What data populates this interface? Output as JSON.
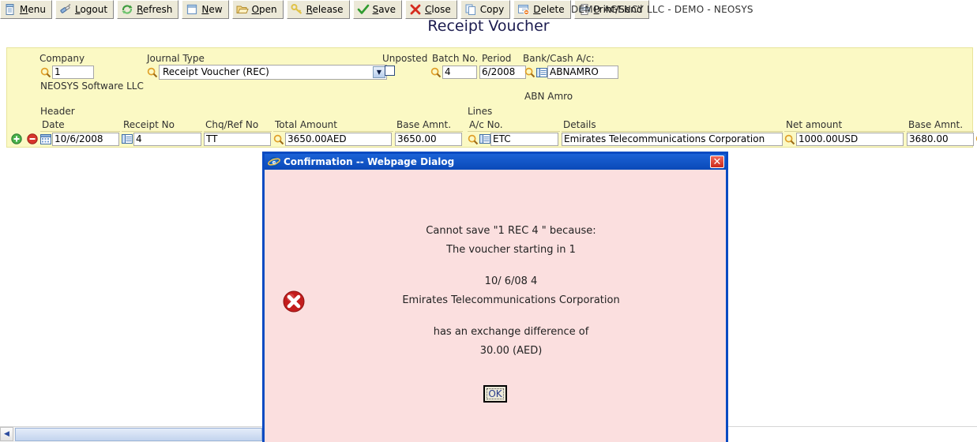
{
  "toolbar": {
    "buttons": [
      {
        "label_pre": "",
        "accel": "M",
        "label_post": "enu",
        "icon": "menu-icon",
        "name": "menu-button"
      },
      {
        "label_pre": "",
        "accel": "L",
        "label_post": "ogout",
        "icon": "logout-icon",
        "name": "logout-button"
      },
      {
        "label_pre": "",
        "accel": "R",
        "label_post": "efresh",
        "icon": "refresh-icon",
        "name": "refresh-button"
      },
      {
        "label_pre": "",
        "accel": "N",
        "label_post": "ew",
        "icon": "new-icon",
        "name": "new-button"
      },
      {
        "label_pre": "",
        "accel": "O",
        "label_post": "pen",
        "icon": "open-folder-icon",
        "name": "open-button"
      },
      {
        "label_pre": "",
        "accel": "R",
        "label_post": "elease",
        "icon": "key-icon",
        "name": "release-button"
      },
      {
        "label_pre": "",
        "accel": "S",
        "label_post": "ave",
        "icon": "check-icon",
        "name": "save-button"
      },
      {
        "label_pre": "",
        "accel": "C",
        "label_post": "lose",
        "icon": "red-x-icon",
        "name": "close-button"
      },
      {
        "label_pre": "",
        "accel": "",
        "label_post": "Copy",
        "icon": "copy-icon",
        "name": "copy-button"
      },
      {
        "label_pre": "",
        "accel": "D",
        "label_post": "elete",
        "icon": "delete-icon",
        "name": "delete-button"
      },
      {
        "label_pre": "",
        "accel": "P",
        "label_post": "rint/Send",
        "icon": "printer-icon",
        "name": "print-send-button"
      }
    ],
    "company_title": "DEMO AGENCY LLC - DEMO - NEOSYS"
  },
  "page": {
    "title": "Receipt Voucher"
  },
  "form": {
    "company": {
      "label": "Company",
      "value": "1",
      "sub": "NEOSYS Software LLC"
    },
    "journal_type": {
      "label": "Journal Type",
      "value": "Receipt Voucher (REC)"
    },
    "unposted": {
      "label": "Unposted",
      "checked": false
    },
    "batch_no": {
      "label": "Batch No.",
      "value": "4"
    },
    "period": {
      "label": "Period",
      "value": "6/2008"
    },
    "bank_cash": {
      "label": "Bank/Cash A/c:",
      "value": "ABNAMRO",
      "sub": "ABN Amro"
    }
  },
  "grid": {
    "group_header": "Header",
    "group_lines": "Lines",
    "header_columns": [
      "Date",
      "Receipt No",
      "Chq/Ref No",
      "Total Amount",
      "Base Amnt."
    ],
    "line_columns": [
      "A/c No.",
      "Details",
      "Net amount",
      "Base Amnt."
    ],
    "row": {
      "date": "10/6/2008",
      "receipt_no": "4",
      "chq_ref_no": "TT",
      "total_amount": "3650.00AED",
      "base_amount_header": "3650.00",
      "ac_no": "ETC",
      "details": "Emirates Telecommunications Corporation",
      "net_amount": "1000.00USD",
      "base_amount_line": "3680.00"
    }
  },
  "dialog": {
    "title": "Confirmation -- Webpage Dialog",
    "close_glyph": "✕",
    "lines": [
      "Cannot save \"1 REC 4 \" because:",
      "The voucher starting in 1",
      "",
      "10/ 6/08 4",
      "Emirates Telecommunications Corporation",
      "",
      "has an exchange difference of",
      "30.00 (AED)"
    ],
    "ok_label": "OK"
  },
  "scrollbar": {
    "left_arrow": "◀"
  },
  "colors": {
    "form_bg": "#fbf9c4",
    "dialog_bg": "#fbdfdf",
    "title_bar": "#0a49b8",
    "accent_red": "#cc2a1c",
    "page_title": "#1b1b4f"
  }
}
